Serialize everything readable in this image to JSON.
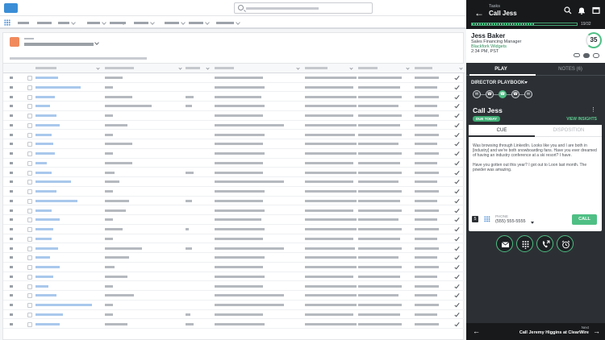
{
  "colors": {
    "accent_green": "#4fbf84",
    "panel_dark": "#2c3034",
    "panel_black": "#17191b",
    "link_blue": "#a9c8ec",
    "header_icon": "#f08a5d"
  },
  "icons": {
    "back": "arrow-left-icon",
    "search": "search-icon",
    "notifications": "bell-icon",
    "window": "popout-icon",
    "apps": "app-launcher-icon"
  },
  "panel": {
    "header": {
      "tasks_label": "Tasks",
      "title": "Call Jess",
      "progress_text": "19/32",
      "progress_fraction": 0.59
    },
    "contact": {
      "name": "Jess Baker",
      "role": "Sales Financing Manager",
      "company": "Blackfork Widgets",
      "time": "2:34 PM, PST",
      "score": "35"
    },
    "tabs": {
      "play": "PLAY",
      "notes": "NOTES (6)"
    },
    "playbook_label": "DIRECTOR PLAYBOOK",
    "steps": [
      {
        "icon": "email-icon",
        "active": false
      },
      {
        "icon": "phone-icon",
        "active": false
      },
      {
        "icon": "phone-icon",
        "active": true
      },
      {
        "icon": "phone-icon",
        "active": false
      },
      {
        "icon": "email-icon",
        "active": false
      }
    ],
    "card": {
      "title": "Call Jess",
      "due_badge": "DUE TODAY",
      "insights_link": "VIEW INSIGHTS",
      "tab_cue": "CUE",
      "tab_disposition": "DISPOSITION",
      "cue_paragraph_1": "Was browsing through LinkedIn. Looks like you and I are both in [industry] and we're both snowboarding fans. Have you ever dreamed of having an industry conference at a ski resort? I have.",
      "cue_paragraph_2": "Have you gotten out this year? I got out to Loon last month. The powder was amazing.",
      "dial_badge": "5",
      "phone_label": "PHONE",
      "phone_number": "(555) 555-5555",
      "call_button": "CALL"
    },
    "actions": [
      "email-icon",
      "dialpad-icon",
      "call-transfer-icon",
      "alarm-icon"
    ],
    "footer": {
      "next_label": "Next",
      "next_task": "Call Jeremy Higgins at ClearWire"
    }
  }
}
